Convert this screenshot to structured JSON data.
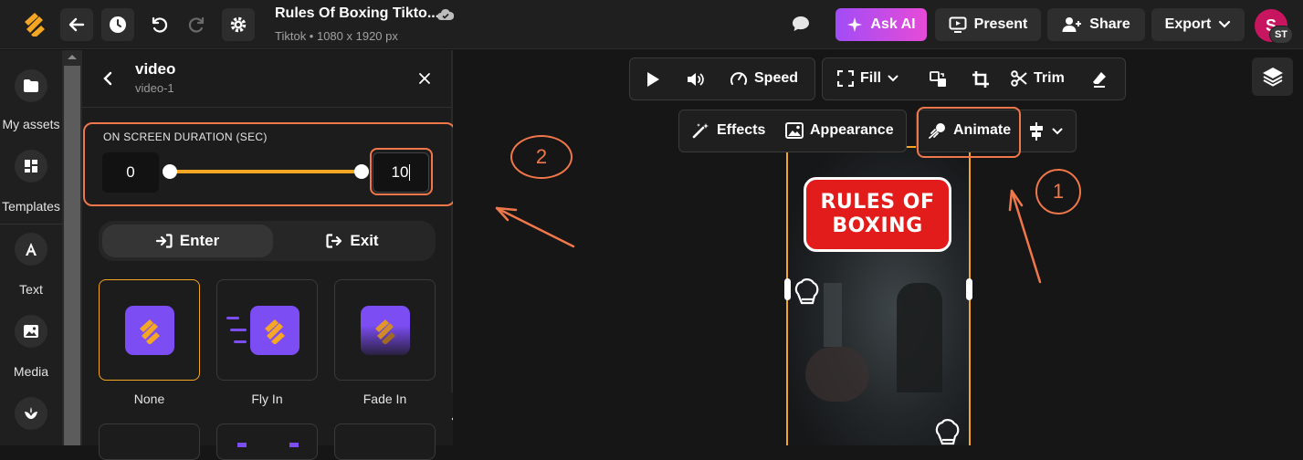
{
  "project": {
    "title": "Rules Of Boxing Tikto...",
    "subtitle": "Tiktok • 1080 x 1920 px"
  },
  "header": {
    "ask_ai": "Ask AI",
    "present": "Present",
    "share": "Share",
    "export": "Export",
    "avatar_letter": "S",
    "avatar_badge": "ST"
  },
  "sidebar": {
    "items": [
      {
        "label": "My assets",
        "icon": "folder-icon"
      },
      {
        "label": "Templates",
        "icon": "templates-icon"
      },
      {
        "label": "Text",
        "icon": "text-icon"
      },
      {
        "label": "Media",
        "icon": "media-icon"
      },
      {
        "label": "",
        "icon": "brand-icon"
      }
    ]
  },
  "panel": {
    "title": "video",
    "subtitle": "video-1",
    "duration_label": "ON SCREEN DURATION (SEC)",
    "duration_start": "0",
    "duration_end": "10",
    "tabs": [
      "Enter",
      "Exit"
    ],
    "active_tab": "Enter",
    "animations": [
      {
        "label": "None",
        "selected": true
      },
      {
        "label": "Fly In",
        "selected": false
      },
      {
        "label": "Fade In",
        "selected": false
      }
    ]
  },
  "toolbar": {
    "speed": "Speed",
    "fill": "Fill",
    "trim": "Trim",
    "effects": "Effects",
    "appearance": "Appearance",
    "animate": "Animate"
  },
  "canvas": {
    "banner_line1": "RULES OF",
    "banner_line2": "BOXING"
  },
  "annotations": {
    "one": "1",
    "two": "2"
  },
  "colors": {
    "accent_orange": "#f5a623",
    "annotation": "#f0774a",
    "ask_ai_gradient": [
      "#a24cf7",
      "#e64bd6"
    ],
    "brand_purple": "#7b4df3",
    "banner_red": "#e21b1b"
  }
}
